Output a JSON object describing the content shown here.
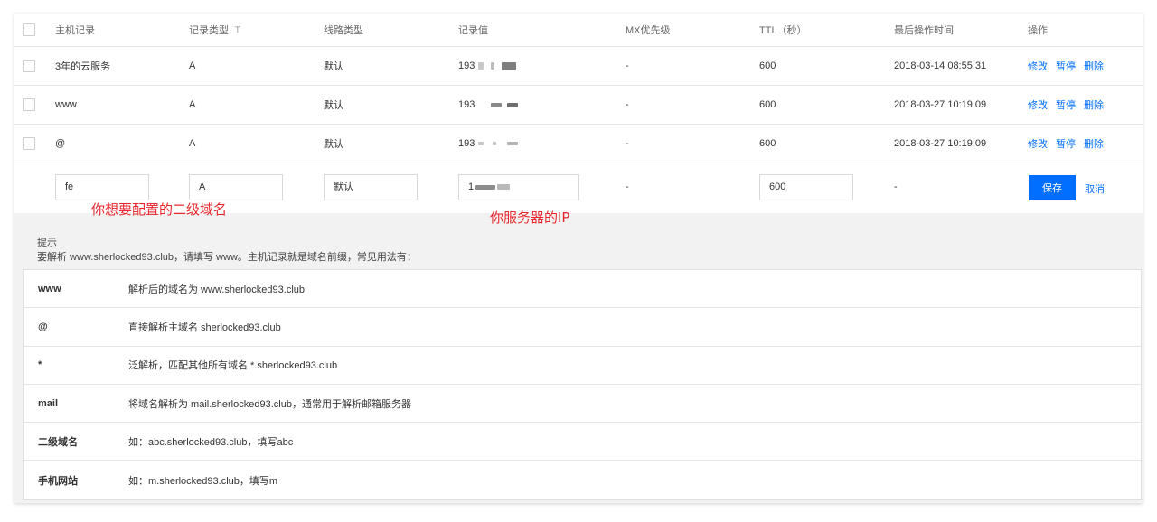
{
  "table": {
    "headers": [
      "主机记录",
      "记录类型",
      "线路类型",
      "记录值",
      "MX优先级",
      "TTL（秒）",
      "最后操作时间",
      "操作"
    ],
    "rows": [
      {
        "host": "3年的云服务",
        "type": "A",
        "line": "默认",
        "value": "193",
        "mx": "-",
        "ttl": "600",
        "time": "2018-03-14 08:55:31"
      },
      {
        "host": "www",
        "type": "A",
        "line": "默认",
        "value": "193",
        "mx": "-",
        "ttl": "600",
        "time": "2018-03-27 10:19:09"
      },
      {
        "host": "@",
        "type": "A",
        "line": "默认",
        "value": "193",
        "mx": "-",
        "ttl": "600",
        "time": "2018-03-27 10:19:09"
      }
    ],
    "ops": {
      "edit": "修改",
      "pause": "暂停",
      "delete": "删除"
    }
  },
  "edit_row": {
    "host": "fe",
    "type": "A",
    "line": "默认",
    "value": "1",
    "mx": "-",
    "ttl": "600",
    "time": "-",
    "save": "保存",
    "cancel": "取消"
  },
  "annotations": {
    "host_hint": "你想要配置的二级域名",
    "ip_hint": "你服务器的IP"
  },
  "tips": {
    "title": "提示",
    "desc": "要解析 www.sherlocked93.club，请填写 www。主机记录就是域名前缀，常见用法有：",
    "rows": [
      {
        "key": "www",
        "val": "解析后的域名为 www.sherlocked93.club"
      },
      {
        "key": "@",
        "val": "直接解析主域名 sherlocked93.club"
      },
      {
        "key": "*",
        "val": "泛解析，匹配其他所有域名 *.sherlocked93.club"
      },
      {
        "key": "mail",
        "val": "将域名解析为 mail.sherlocked93.club，通常用于解析邮箱服务器"
      },
      {
        "key": "二级域名",
        "val": "如：abc.sherlocked93.club，填写abc"
      },
      {
        "key": "手机网站",
        "val": "如：m.sherlocked93.club，填写m"
      }
    ]
  },
  "colors": {
    "accent": "#006eff",
    "annotation": "#e8262b",
    "tip_bg": "#f2f2f2"
  },
  "icons": {
    "filter": "filter-icon"
  }
}
